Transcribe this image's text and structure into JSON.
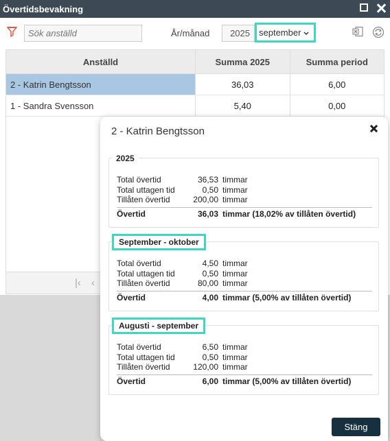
{
  "window": {
    "title": "Övertidsbevakning"
  },
  "toolbar": {
    "search_placeholder": "Sök anställd",
    "year_month_label": "År/månad",
    "year": "2025",
    "month": "september"
  },
  "grid": {
    "columns": [
      "Anställd",
      "Summa 2025",
      "Summa period"
    ],
    "rows": [
      {
        "employee": "2 - Katrin Bengtsson",
        "sum_year": "36,03",
        "sum_period": "6,00"
      },
      {
        "employee": "1 - Sandra Svensson",
        "sum_year": "5,40",
        "sum_period": "0,00"
      }
    ]
  },
  "dialog": {
    "title": "2 - Katrin Bengtsson",
    "close_label": "Stäng",
    "sections": [
      {
        "heading": "2025",
        "rows": [
          {
            "label": "Total övertid",
            "value": "36,53",
            "unit": "timmar"
          },
          {
            "label": "Total uttagen tid",
            "value": "0,50",
            "unit": "timmar"
          },
          {
            "label": "Tillåten övertid",
            "value": "200,00",
            "unit": "timmar"
          }
        ],
        "total": {
          "label": "Övertid",
          "value": "36,03",
          "unit": "timmar (18,02% av tillåten övertid)"
        }
      },
      {
        "heading": "September - oktober",
        "rows": [
          {
            "label": "Total övertid",
            "value": "4,50",
            "unit": "timmar"
          },
          {
            "label": "Total uttagen tid",
            "value": "0,50",
            "unit": "timmar"
          },
          {
            "label": "Tillåten övertid",
            "value": "80,00",
            "unit": "timmar"
          }
        ],
        "total": {
          "label": "Övertid",
          "value": "4,00",
          "unit": "timmar (5,00% av tillåten övertid)"
        }
      },
      {
        "heading": "Augusti - september",
        "rows": [
          {
            "label": "Total övertid",
            "value": "6,50",
            "unit": "timmar"
          },
          {
            "label": "Total uttagen tid",
            "value": "0,50",
            "unit": "timmar"
          },
          {
            "label": "Tillåten övertid",
            "value": "120,00",
            "unit": "timmar"
          }
        ],
        "total": {
          "label": "Övertid",
          "value": "6,00",
          "unit": "timmar (5,00% av tillåten övertid)"
        }
      }
    ]
  },
  "colors": {
    "titlebar": "#3d4a56",
    "highlight": "#3fd6c4",
    "selected_row": "#a9c7e3",
    "button": "#17303f"
  }
}
